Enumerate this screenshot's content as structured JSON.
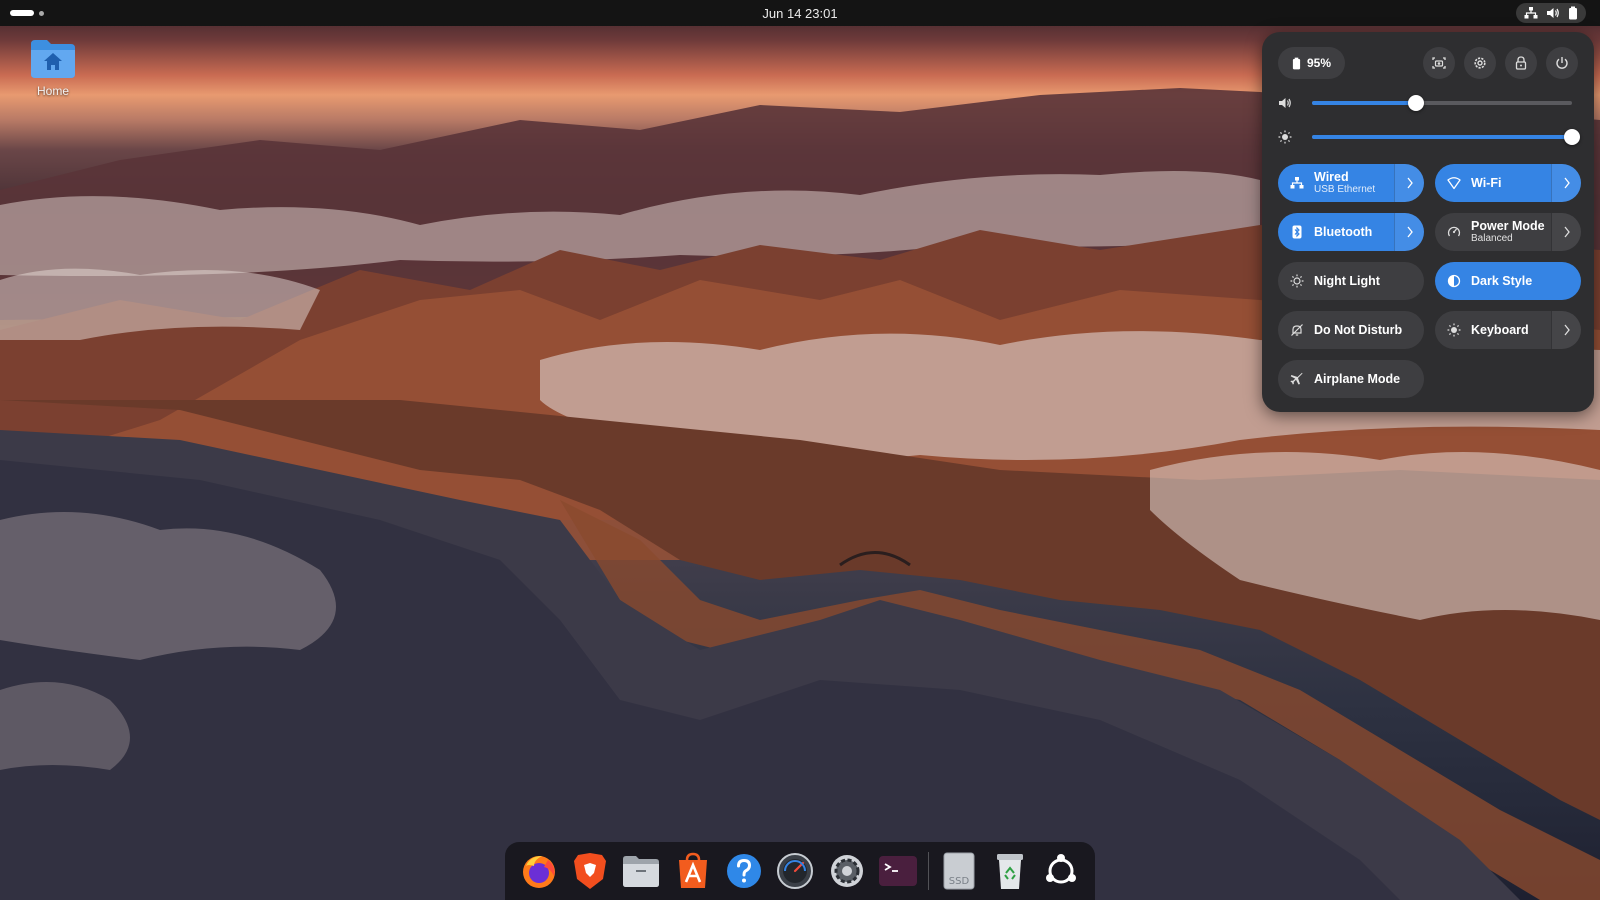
{
  "topbar": {
    "datetime": "Jun 14  23:01",
    "indicators": [
      "network-icon",
      "volume-icon",
      "battery-icon"
    ]
  },
  "desktop": {
    "icons": [
      {
        "label": "Home",
        "icon": "home-folder-icon"
      }
    ]
  },
  "quick_settings": {
    "battery_label": "95%",
    "actions": [
      "screenshot-icon",
      "settings-icon",
      "lock-icon",
      "power-icon"
    ],
    "volume": {
      "level": 0.4,
      "icon": "volume-icon"
    },
    "brightness": {
      "level": 1.0,
      "icon": "brightness-icon"
    },
    "tiles": [
      {
        "title": "Wired",
        "subtitle": "USB Ethernet",
        "on": true,
        "arrow": true,
        "icon": "wired-network-icon"
      },
      {
        "title": "Wi-Fi",
        "subtitle": "",
        "on": true,
        "arrow": true,
        "icon": "wifi-icon"
      },
      {
        "title": "Bluetooth",
        "subtitle": "",
        "on": true,
        "arrow": true,
        "icon": "bluetooth-icon"
      },
      {
        "title": "Power Mode",
        "subtitle": "Balanced",
        "on": false,
        "arrow": true,
        "icon": "power-mode-icon"
      },
      {
        "title": "Night Light",
        "subtitle": "",
        "on": false,
        "arrow": false,
        "icon": "night-light-icon"
      },
      {
        "title": "Dark Style",
        "subtitle": "",
        "on": true,
        "arrow": false,
        "icon": "dark-style-icon"
      },
      {
        "title": "Do Not Disturb",
        "subtitle": "",
        "on": false,
        "arrow": false,
        "icon": "do-not-disturb-icon"
      },
      {
        "title": "Keyboard",
        "subtitle": "",
        "on": false,
        "arrow": true,
        "icon": "keyboard-icon"
      },
      {
        "title": "Airplane Mode",
        "subtitle": "",
        "on": false,
        "arrow": false,
        "icon": "airplane-icon"
      }
    ],
    "accent_color": "#3584e4"
  },
  "dock": {
    "apps": [
      "firefox-icon",
      "brave-icon",
      "files-icon",
      "app-center-icon",
      "help-icon",
      "disk-usage-icon",
      "settings-icon",
      "terminal-icon"
    ],
    "drive_label": "SSD",
    "extras": [
      "trash-icon",
      "show-apps-icon"
    ]
  }
}
